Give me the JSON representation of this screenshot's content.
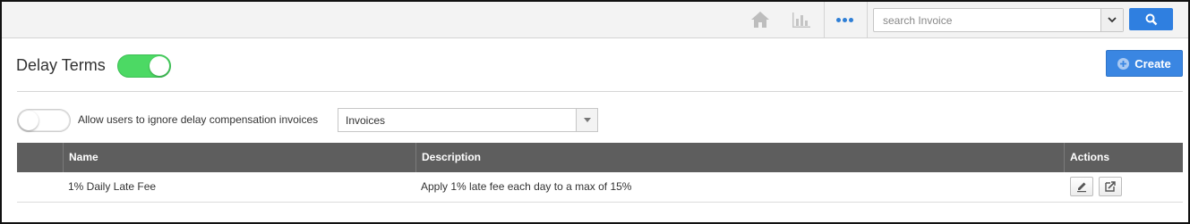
{
  "topbar": {
    "icons": {
      "home": "home-icon",
      "chart": "bar-chart-icon",
      "more": "more-dots-icon"
    },
    "search": {
      "placeholder": "search Invoice",
      "button_icon": "search-icon",
      "dropdown_icon": "chevron-down-icon"
    }
  },
  "header": {
    "title": "Delay Terms",
    "enabled": true,
    "create_label": "Create"
  },
  "options": {
    "allow_ignore_label": "Allow users to ignore delay compensation invoices",
    "allow_ignore_enabled": false,
    "scope_select_value": "Invoices"
  },
  "table": {
    "columns": [
      "Name",
      "Description",
      "Actions"
    ],
    "rows": [
      {
        "name": "1% Daily Late Fee",
        "description": "Apply 1% late fee each day to a max of 15%"
      }
    ]
  },
  "colors": {
    "accent": "#2f7fe0",
    "toggle_on": "#4cd964",
    "table_header": "#5e5e5e"
  }
}
